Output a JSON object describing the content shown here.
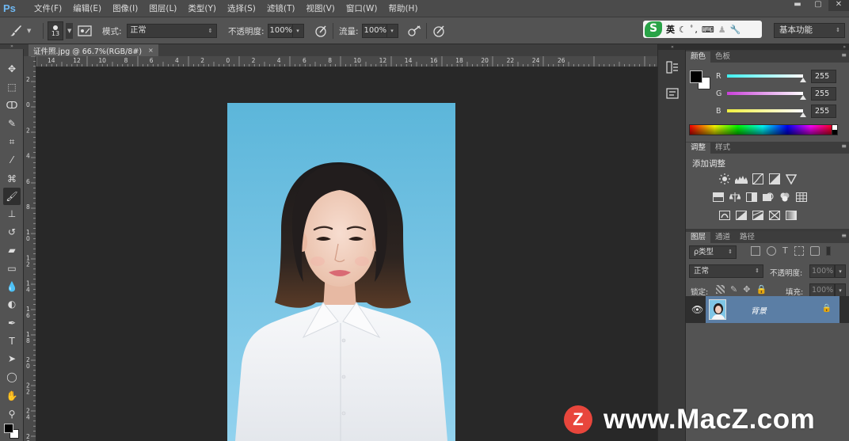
{
  "app": {
    "logo": "Ps"
  },
  "menu": [
    "文件(F)",
    "编辑(E)",
    "图像(I)",
    "图层(L)",
    "类型(Y)",
    "选择(S)",
    "滤镜(T)",
    "视图(V)",
    "窗口(W)",
    "帮助(H)"
  ],
  "window_controls": {
    "minimize": "▬",
    "maximize": "▢",
    "close": "✕"
  },
  "options": {
    "brush_size": "13",
    "mode_label": "模式:",
    "mode_value": "正常",
    "opacity_label": "不透明度:",
    "opacity_value": "100%",
    "flow_label": "流量:",
    "flow_value": "100%"
  },
  "ime": {
    "logo": "S",
    "lang": "英",
    "icons": [
      "moon-icon",
      "comma-icon",
      "keyboard-icon",
      "user-icon",
      "wrench-icon"
    ]
  },
  "workspace": "基本功能",
  "document": {
    "tab_title": "证件照.jpg @ 66.7%(RGB/8#)",
    "close": "×"
  },
  "rulers": {
    "top": [
      "14",
      "12",
      "10",
      "8",
      "6",
      "4",
      "2",
      "0",
      "2",
      "4",
      "6",
      "8",
      "10",
      "12",
      "14",
      "16",
      "18",
      "20",
      "22",
      "24",
      "26"
    ],
    "left": [
      "2",
      "0",
      "2",
      "4",
      "6",
      "8",
      "1 0",
      "1 2",
      "1 4",
      "1 6",
      "1 8",
      "2 0",
      "2 2",
      "2 4",
      "2 6"
    ]
  },
  "tools": [
    "move-tool-icon",
    "marquee-tool-icon",
    "lasso-tool-icon",
    "quick-select-tool-icon",
    "crop-tool-icon",
    "eyedropper-tool-icon",
    "healing-brush-tool-icon",
    "brush-tool-icon",
    "clone-stamp-tool-icon",
    "history-brush-tool-icon",
    "eraser-tool-icon",
    "gradient-tool-icon",
    "blur-tool-icon",
    "dodge-tool-icon",
    "pen-tool-icon",
    "type-tool-icon",
    "path-select-tool-icon",
    "ellipse-tool-icon",
    "hand-tool-icon",
    "zoom-tool-icon"
  ],
  "color_panel": {
    "tabs": [
      "颜色",
      "色板"
    ],
    "channels": [
      {
        "label": "R",
        "value": "255",
        "color": "#3fd7e6"
      },
      {
        "label": "G",
        "value": "255",
        "color": "#d64fd6"
      },
      {
        "label": "B",
        "value": "255",
        "color": "#e6e63f"
      }
    ]
  },
  "adjust_panel": {
    "tabs": [
      "调整",
      "样式"
    ],
    "title": "添加调整"
  },
  "layers_panel": {
    "tabs": [
      "图层",
      "通道",
      "路径"
    ],
    "filter": "ρ类型",
    "blend_mode": "正常",
    "opacity_label": "不透明度:",
    "opacity_value": "100%",
    "lock_label": "锁定:",
    "fill_label": "填充:",
    "fill_value": "100%",
    "layer_name": "背景"
  },
  "watermark": {
    "logo": "Z",
    "text": "www.MacZ.com"
  },
  "colors": {
    "photo_bg_top": "#5fb7da",
    "photo_bg_bottom": "#8fd0ee",
    "layer_selected": "#5b7ea5"
  }
}
